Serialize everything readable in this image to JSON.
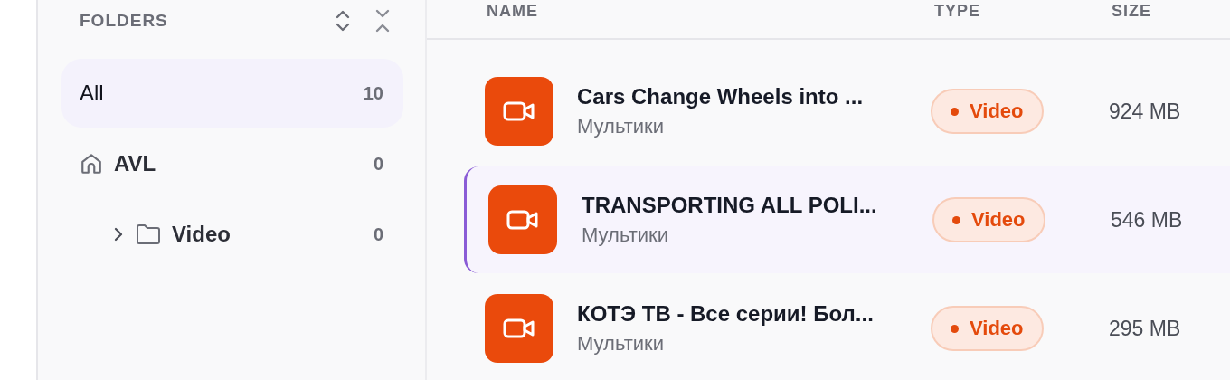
{
  "sidebar": {
    "title": "FOLDERS",
    "items": [
      {
        "label": "All",
        "count": "10",
        "selected": true,
        "kind": "all"
      },
      {
        "label": "AVL",
        "count": "0",
        "selected": false,
        "kind": "home",
        "children": [
          {
            "label": "Video",
            "count": "0",
            "selected": false,
            "kind": "folder",
            "expanded": false
          }
        ]
      }
    ]
  },
  "table": {
    "columns": [
      "NAME",
      "TYPE",
      "SIZE"
    ],
    "rows": [
      {
        "name": "Cars Change Wheels into ...",
        "folder": "Мультики",
        "type": "Video",
        "size": "924 MB",
        "selected": false
      },
      {
        "name": "TRANSPORTING ALL POLI...",
        "folder": "Мультики",
        "type": "Video",
        "size": "546 MB",
        "selected": true
      },
      {
        "name": "КОТЭ ТВ - Все серии! Бол...",
        "folder": "Мультики",
        "type": "Video",
        "size": "295 MB",
        "selected": false
      }
    ]
  }
}
